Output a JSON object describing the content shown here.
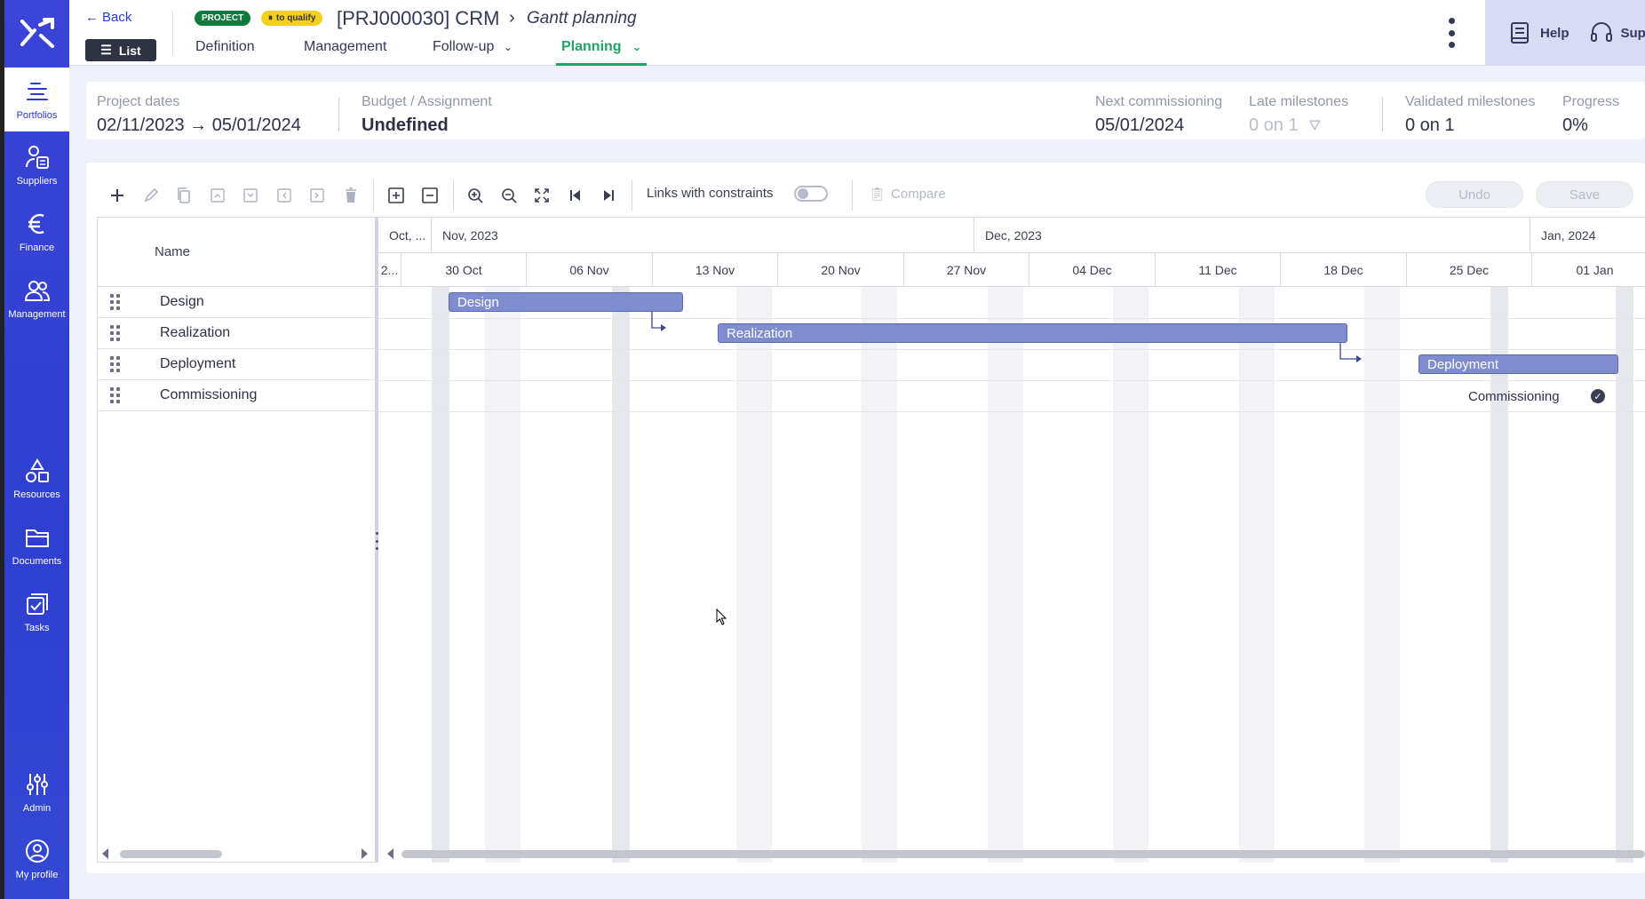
{
  "sidebar": {
    "items": [
      {
        "label": "Portfolios",
        "icon": "portfolios-icon",
        "active": true
      },
      {
        "label": "Suppliers",
        "icon": "suppliers-icon"
      },
      {
        "label": "Finance",
        "icon": "euro-icon"
      },
      {
        "label": "Management",
        "icon": "users-icon"
      },
      {
        "label": "Resources",
        "icon": "shapes-icon"
      },
      {
        "label": "Documents",
        "icon": "folder-icon"
      },
      {
        "label": "Tasks",
        "icon": "tasks-icon"
      },
      {
        "label": "Admin",
        "icon": "sliders-icon"
      },
      {
        "label": "My profile",
        "icon": "profile-icon"
      }
    ]
  },
  "header": {
    "back_label": "Back",
    "list_label": "List",
    "badge_project": "PROJECT",
    "badge_status": "to qualify",
    "title": "[PRJ000030] CRM",
    "page": "Gantt planning",
    "tabs": [
      {
        "label": "Definition"
      },
      {
        "label": "Management"
      },
      {
        "label": "Follow-up"
      },
      {
        "label": "Planning",
        "active": true
      }
    ],
    "help_label": "Help",
    "support_label": "Support"
  },
  "summary": {
    "project_dates_label": "Project dates",
    "project_dates_value": "02/11/2023 → 05/01/2024",
    "budget_label": "Budget / Assignment",
    "budget_value": "Undefined",
    "next_commissioning_label": "Next commissioning",
    "next_commissioning_value": "05/01/2024",
    "late_milestones_label": "Late milestones",
    "late_milestones_value": "0 on 1",
    "validated_milestones_label": "Validated milestones",
    "validated_milestones_value": "0 on 1",
    "progress_label": "Progress",
    "progress_value": "0%"
  },
  "toolbar": {
    "links_label": "Links with constraints",
    "links_enabled": false,
    "compare_label": "Compare",
    "undo_label": "Undo",
    "save_label": "Save"
  },
  "grid": {
    "name_header": "Name",
    "rows": [
      {
        "name": "Design"
      },
      {
        "name": "Realization"
      },
      {
        "name": "Deployment"
      },
      {
        "name": "Commissioning"
      }
    ]
  },
  "timeline": {
    "months": [
      "Oct, ...",
      "Nov, 2023",
      "Dec, 2023",
      "Jan, 2024"
    ],
    "weeks": [
      "2...",
      "30 Oct",
      "06 Nov",
      "13 Nov",
      "20 Nov",
      "27 Nov",
      "04 Dec",
      "11 Dec",
      "18 Dec",
      "25 Dec",
      "01 Jan"
    ],
    "tasks": [
      {
        "label": "Design",
        "start": "2023-11-02",
        "end": "2023-11-21"
      },
      {
        "label": "Realization",
        "start": "2023-11-24",
        "end": "2023-12-24"
      },
      {
        "label": "Deployment",
        "start": "2023-12-29",
        "end": "2024-01-05"
      }
    ],
    "milestone": {
      "label": "Commissioning",
      "date": "2024-01-05"
    }
  },
  "colors": {
    "sidebar": "#3a44d6",
    "accent_green": "#1ea466",
    "task_bar": "#7f8dcf",
    "badge_project": "#0e7a3c",
    "badge_status": "#f5cf1e"
  }
}
